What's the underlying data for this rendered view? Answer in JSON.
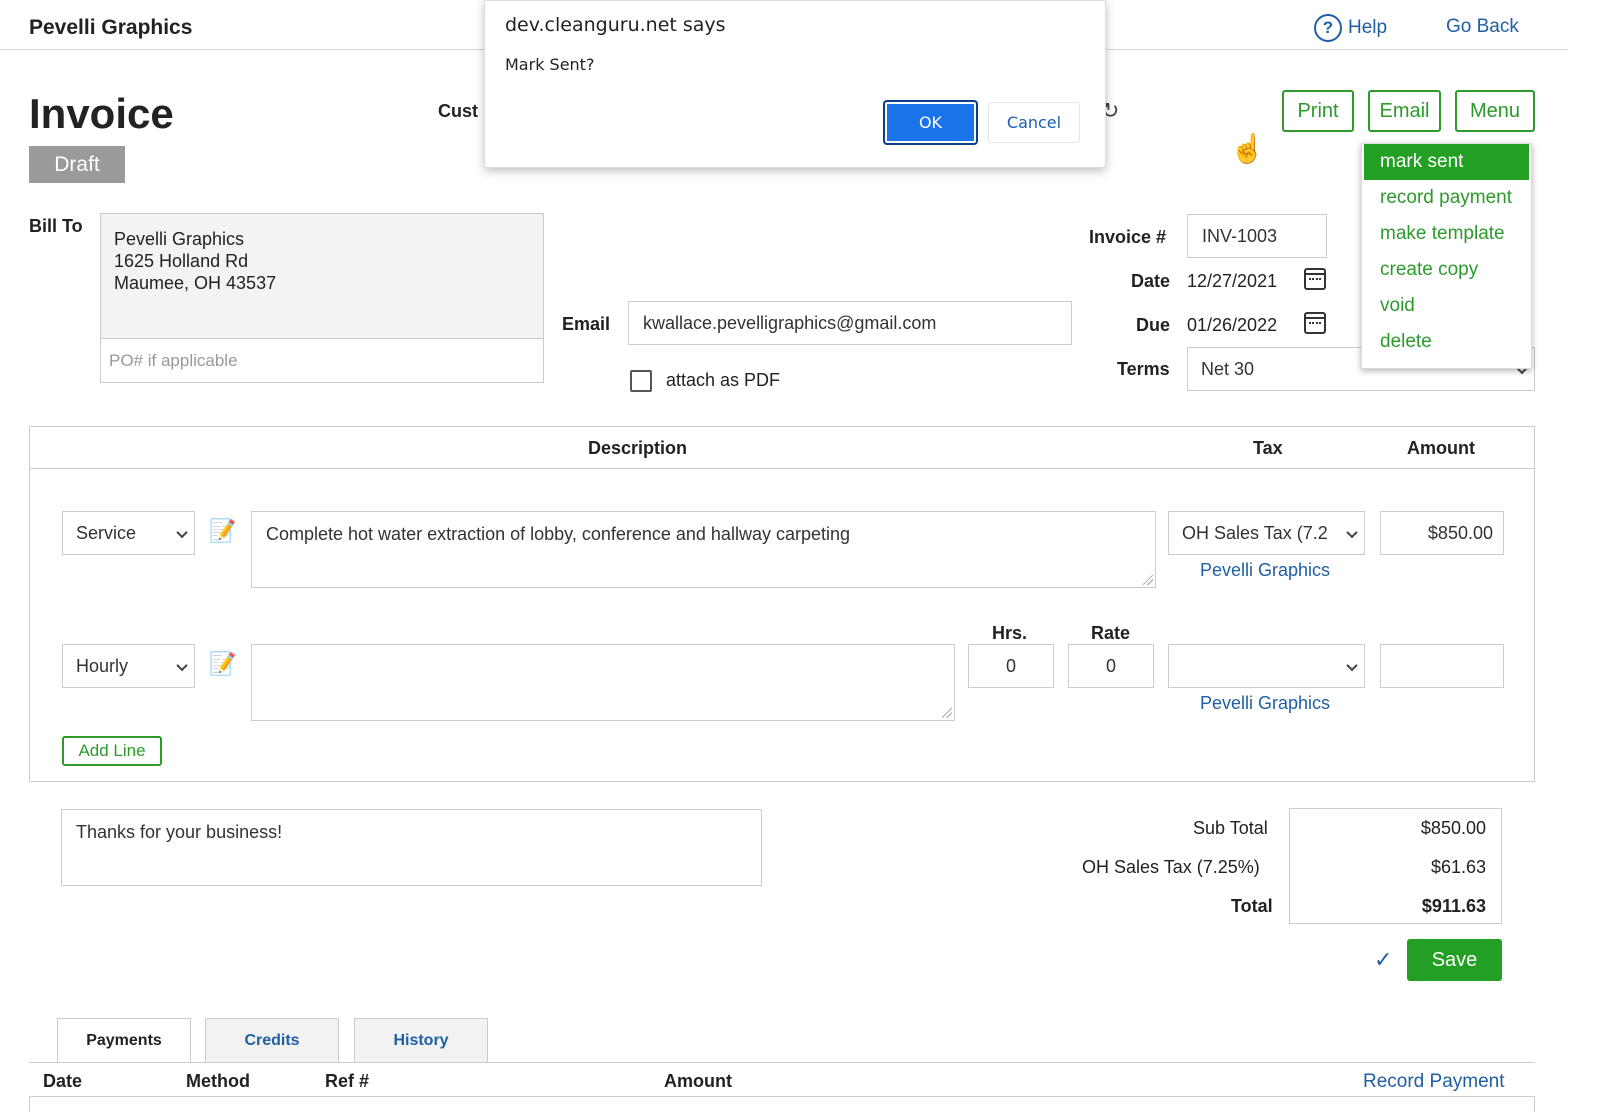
{
  "app": {
    "brand": "Pevelli Graphics",
    "help": "Help",
    "go_back": "Go Back"
  },
  "invoice": {
    "title": "Invoice",
    "status": "Draft",
    "customer_label": "Cust",
    "bill_to_label": "Bill To",
    "bill_to_lines": [
      "Pevelli Graphics",
      "1625 Holland Rd",
      "Maumee, OH 43537"
    ],
    "po_placeholder": "PO# if applicable",
    "email_label": "Email",
    "email_value": "kwallace.pevelligraphics@gmail.com",
    "attach_pdf_label": "attach as PDF",
    "attach_pdf_checked": false,
    "invoice_no_label": "Invoice #",
    "invoice_no": "INV-1003",
    "date_label": "Date",
    "date": "12/27/2021",
    "due_label": "Due",
    "due": "01/26/2022",
    "terms_label": "Terms",
    "terms": "Net 30"
  },
  "actions": {
    "print": "Print",
    "email": "Email",
    "menu": "Menu"
  },
  "menu_items": [
    "mark sent",
    "record payment",
    "make template",
    "create copy",
    "void",
    "delete"
  ],
  "lines": {
    "headers": {
      "description": "Description",
      "tax": "Tax",
      "amount": "Amount",
      "hrs": "Hrs.",
      "rate": "Rate"
    },
    "rows": [
      {
        "type": "Service",
        "description": "Complete hot water extraction of lobby, conference and hallway carpeting",
        "tax": "OH Sales Tax (7.2",
        "tax_agency": "Pevelli Graphics",
        "amount": "$850.00"
      },
      {
        "type": "Hourly",
        "description": "",
        "hrs": "0",
        "rate": "0",
        "tax": "",
        "tax_agency": "Pevelli Graphics",
        "amount": ""
      }
    ],
    "add_line": "Add Line"
  },
  "footer_note": "Thanks for your business!",
  "totals": {
    "subtotal_label": "Sub Total",
    "subtotal": "$850.00",
    "tax_label": "OH Sales Tax (7.25%)",
    "tax": "$61.63",
    "total_label": "Total",
    "total": "$911.63"
  },
  "save": "Save",
  "tabs": [
    "Payments",
    "Credits",
    "History"
  ],
  "payments": {
    "headers": [
      "Date",
      "Method",
      "Ref #",
      "Amount"
    ],
    "record_payment": "Record Payment"
  },
  "dialog": {
    "title": "dev.cleanguru.net says",
    "message": "Mark Sent?",
    "ok": "OK",
    "cancel": "Cancel"
  },
  "colors": {
    "green": "#23a023",
    "blue_link": "#1f5fa3",
    "dialog_ok": "#1a73e8",
    "draft_badge": "#9a9a9a"
  }
}
